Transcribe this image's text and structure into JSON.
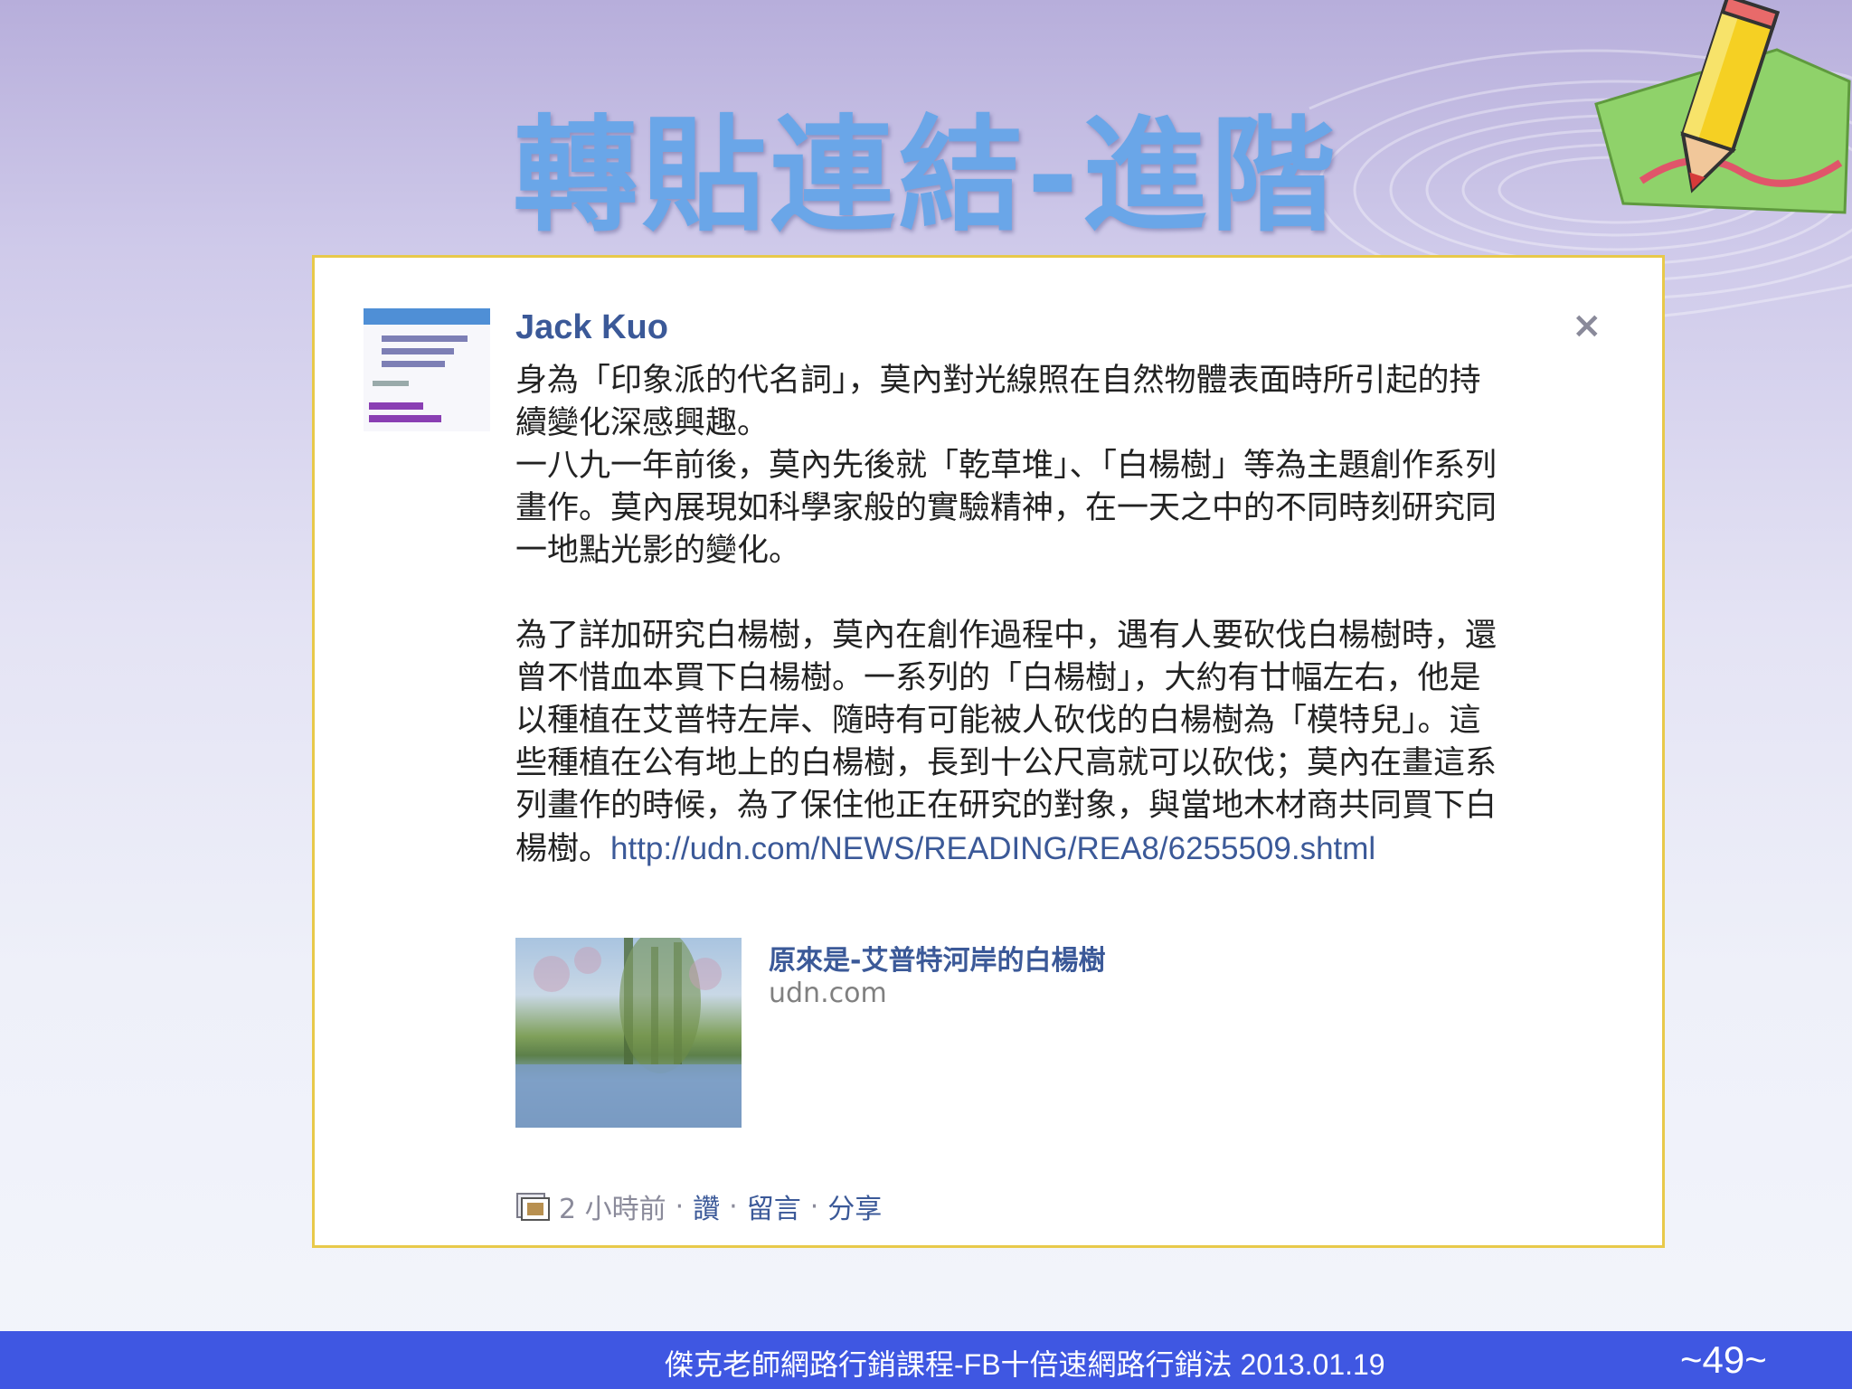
{
  "slide": {
    "title": "轉貼連結-進階",
    "footer": "傑克老師網路行銷課程-FB十倍速網路行銷法 2013.01.19",
    "page_number": "~49~"
  },
  "post": {
    "author": "Jack Kuo",
    "close_symbol": "×",
    "body": "身為「印象派的代名詞」，莫內對光線照在自然物體表面時所引起的持續變化深感興趣。\n一八九一年前後，莫內先後就「乾草堆」、「白楊樹」等為主題創作系列畫作。莫內展現如科學家般的實驗精神，在一天之中的不同時刻研究同一地點光影的變化。\n\n為了詳加研究白楊樹，莫內在創作過程中，遇有人要砍伐白楊樹時，還曾不惜血本買下白楊樹。一系列的「白楊樹」，大約有廿幅左右，他是以種植在艾普特左岸、隨時有可能被人砍伐的白楊樹為「模特兒」。這些種植在公有地上的白楊樹，長到十公尺高就可以砍伐；莫內在畫這系列畫作的時候，為了保住他正在研究的對象，與當地木材商共同買下白楊樹。",
    "link_url": "http://udn.com/NEWS/READING/REA8/6255509.shtml",
    "link_preview": {
      "title": "原來是-艾普特河岸的白楊樹",
      "domain": "udn.com"
    },
    "meta": {
      "time": "2 小時前",
      "sep": "·",
      "like": "讚",
      "comment": "留言",
      "share": "分享"
    }
  }
}
